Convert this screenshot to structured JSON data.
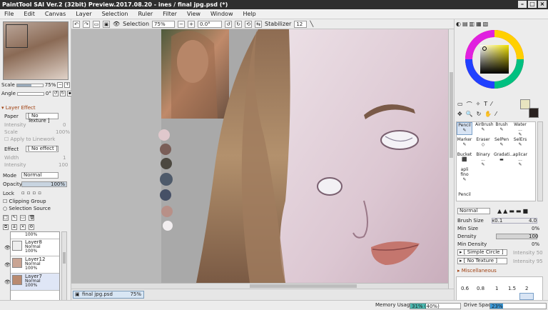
{
  "window": {
    "title": "PaintTool SAI Ver.2 (32bit) Preview.2017.08.20 - ines / final jpg.psd (*)"
  },
  "menu": [
    "File",
    "Edit",
    "Canvas",
    "Layer",
    "Selection",
    "Ruler",
    "Filter",
    "View",
    "Window",
    "Help"
  ],
  "toolbar": {
    "selection_label": "Selection",
    "zoom": "75%",
    "rotation": "0.0°",
    "stabilizer_label": "Stabilizer",
    "stabilizer": "12"
  },
  "navigator": {
    "scale_label": "Scale",
    "scale": "75%",
    "angle_label": "Angle",
    "angle": "0°"
  },
  "layer_effect": {
    "title": "Layer Effect",
    "paper_label": "Paper",
    "paper": "[ No Texture ]",
    "intensity_label": "Intensity",
    "intensity": "0",
    "scale_label": "Scale",
    "scale": "100%",
    "apply_linework": "Apply to Linework",
    "effect_label": "Effect",
    "effect": "[ No effect ]",
    "width_label": "Width",
    "width": "1",
    "intensity2_label": "Intensity",
    "intensity2": "100"
  },
  "layer_props": {
    "mode_label": "Mode",
    "mode": "Normal",
    "opacity_label": "Opacity",
    "opacity": "100%",
    "opacity_fraction": 1.0,
    "lock_label": "Lock",
    "clipping_group": "Clipping Group",
    "selection_source": "Selection Source"
  },
  "layers": [
    {
      "name": "",
      "mode": "100%"
    },
    {
      "name": "Layer8",
      "mode": "Normal",
      "opacity": "100%"
    },
    {
      "name": "Layer12",
      "mode": "Normal",
      "opacity": "100%"
    },
    {
      "name": "Layer7",
      "mode": "Normal",
      "opacity": "100%"
    }
  ],
  "document_tab": {
    "name": "final jpg.psd",
    "zoom": "75%"
  },
  "tools": [
    "Pencil",
    "AirBrush",
    "Brush",
    "Water ...",
    "Marker",
    "Eraser",
    "SelPen",
    "SelErs",
    "Bucket",
    "Binary ...",
    "Gradati...",
    "aplicar ...",
    "apli fino",
    "",
    "",
    "",
    "Pencil"
  ],
  "brush": {
    "mode": "Normal",
    "size_label": "Brush Size",
    "size_mult": "x0.1",
    "size": "4.0",
    "min_size_label": "Min Size",
    "min_size": "0%",
    "density_label": "Density",
    "density": "100",
    "min_density_label": "Min Density",
    "min_density": "0%",
    "shape": "[ Simple Circle ]",
    "shape_intensity": "Intensity",
    "shape_intensity_val": "50",
    "texture": "[ No Texture ]",
    "texture_intensity": "Intensity",
    "texture_intensity_val": "95",
    "misc": "Miscellaneous",
    "presets": [
      "0.6",
      "0.8",
      "1",
      "1.5",
      "2"
    ]
  },
  "status": {
    "memory_label": "Memory Usage",
    "memory": "31% (40%)",
    "memory_fraction": 0.31,
    "drive_label": "Drive Space",
    "drive": "23%",
    "drive_fraction": 0.23
  },
  "colors": {
    "primary": "#e8e4c0",
    "secondary": "#2a2220",
    "accent": "#3a78c8"
  }
}
